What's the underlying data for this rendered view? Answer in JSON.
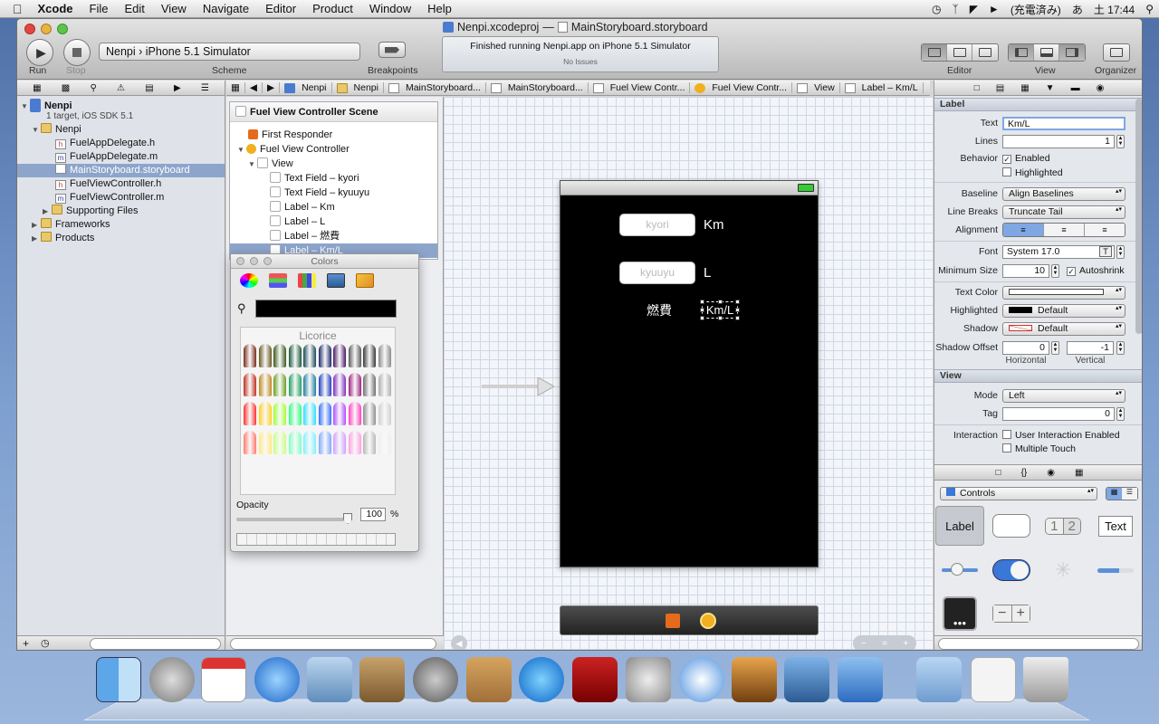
{
  "menubar": {
    "app_name": "Xcode",
    "items": [
      "File",
      "Edit",
      "View",
      "Navigate",
      "Editor",
      "Product",
      "Window",
      "Help"
    ],
    "status_power": "(充電済み)",
    "status_ime": "あ",
    "status_clock": "土 17:44"
  },
  "window": {
    "title_project": "Nenpi.xcodeproj",
    "title_separator": "—",
    "title_file": "MainStoryboard.storyboard"
  },
  "toolbar": {
    "run_label": "Run",
    "stop_label": "Stop",
    "scheme_target": "Nenpi",
    "scheme_device": "iPhone 5.1 Simulator",
    "scheme_label": "Scheme",
    "breakpoints_label": "Breakpoints",
    "activity_message": "Finished running Nenpi.app on iPhone 5.1 Simulator",
    "activity_sub": "No Issues",
    "editor_label": "Editor",
    "view_label": "View",
    "organizer_label": "Organizer"
  },
  "navigator": {
    "project_name": "Nenpi",
    "project_sub": "1 target, iOS SDK 5.1",
    "group_name": "Nenpi",
    "files": [
      "FuelAppDelegate.h",
      "FuelAppDelegate.m",
      "MainStoryboard.storyboard",
      "FuelViewController.h",
      "FuelViewController.m"
    ],
    "supporting": "Supporting Files",
    "frameworks": "Frameworks",
    "products": "Products"
  },
  "jumpbar": [
    "Nenpi",
    "Nenpi",
    "MainStoryboard...",
    "MainStoryboard...",
    "Fuel View Contr...",
    "Fuel View Contr...",
    "View",
    "Label – Km/L"
  ],
  "outline": {
    "scene_title": "Fuel View Controller Scene",
    "first_responder": "First Responder",
    "controller": "Fuel View Controller",
    "view": "View",
    "children": [
      "Text Field – kyori",
      "Text Field – kyuuyu",
      "Label – Km",
      "Label – L",
      "Label – 燃費",
      "Label – Km/L"
    ]
  },
  "colors_panel": {
    "title": "Colors",
    "palette_name": "Licorice",
    "opacity_label": "Opacity",
    "opacity_value": "100",
    "opacity_unit": "%",
    "opacity_fraction": 1.0
  },
  "phone": {
    "field1_placeholder": "kyori",
    "field2_placeholder": "kyuuyu",
    "label_km": "Km",
    "label_l": "L",
    "label_nenpi": "燃費",
    "label_kml": "Km/L"
  },
  "inspector": {
    "label_section": "Label",
    "text_label": "Text",
    "text_value": "Km/L",
    "lines_label": "Lines",
    "lines_value": "1",
    "behavior_label": "Behavior",
    "enabled": "Enabled",
    "highlighted_cb": "Highlighted",
    "baseline_label": "Baseline",
    "baseline_value": "Align Baselines",
    "linebreaks_label": "Line Breaks",
    "linebreaks_value": "Truncate Tail",
    "alignment_label": "Alignment",
    "font_label": "Font",
    "font_value": "System 17.0",
    "minsize_label": "Minimum Size",
    "minsize_value": "10",
    "autoshrink": "Autoshrink",
    "textcolor_label": "Text Color",
    "highlighted_label": "Highlighted",
    "highlighted_value": "Default",
    "shadow_label": "Shadow",
    "shadow_value": "Default",
    "shadowoffset_label": "Shadow Offset",
    "shadow_h": "0",
    "shadow_v": "-1",
    "horizontal": "Horizontal",
    "vertical": "Vertical",
    "view_section": "View",
    "mode_label": "Mode",
    "mode_value": "Left",
    "tag_label": "Tag",
    "tag_value": "0",
    "interaction_label": "Interaction",
    "user_interaction": "User Interaction Enabled",
    "multiple_touch": "Multiple Touch"
  },
  "library": {
    "category": "Controls",
    "tile_label": "Label",
    "tile_text": "Text",
    "tile_seg1": "1",
    "tile_seg2": "2"
  },
  "colors": {
    "selection": "#8da5cb",
    "accent_blue": "#3a78d8"
  }
}
